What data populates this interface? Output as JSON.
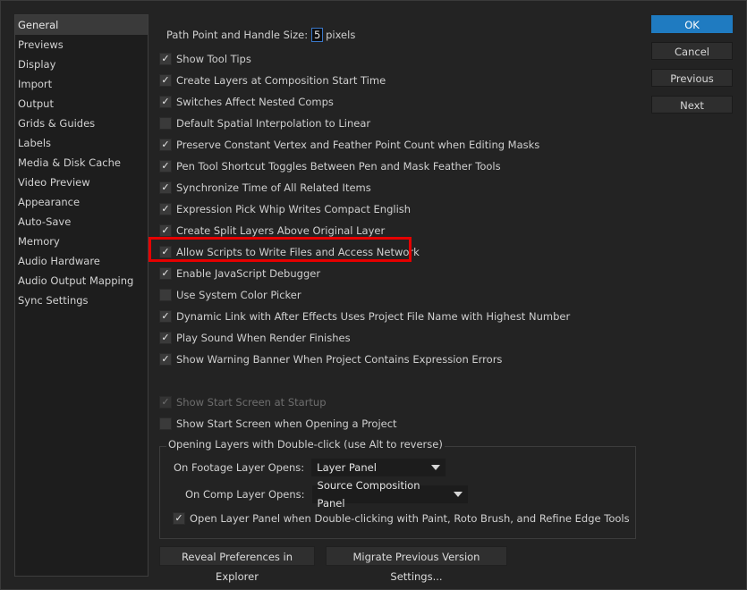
{
  "sidebar": {
    "items": [
      {
        "label": "General",
        "active": true
      },
      {
        "label": "Previews"
      },
      {
        "label": "Display"
      },
      {
        "label": "Import"
      },
      {
        "label": "Output"
      },
      {
        "label": "Grids & Guides"
      },
      {
        "label": "Labels"
      },
      {
        "label": "Media & Disk Cache"
      },
      {
        "label": "Video Preview"
      },
      {
        "label": "Appearance"
      },
      {
        "label": "Auto-Save"
      },
      {
        "label": "Memory"
      },
      {
        "label": "Audio Hardware"
      },
      {
        "label": "Audio Output Mapping"
      },
      {
        "label": "Sync Settings"
      }
    ]
  },
  "path_point": {
    "label": "Path Point and Handle Size:",
    "value": "5",
    "unit": "pixels"
  },
  "checkboxes": [
    {
      "label": "Show Tool Tips",
      "checked": true
    },
    {
      "label": "Create Layers at Composition Start Time",
      "checked": true
    },
    {
      "label": "Switches Affect Nested Comps",
      "checked": true
    },
    {
      "label": "Default Spatial Interpolation to Linear",
      "checked": false
    },
    {
      "label": "Preserve Constant Vertex and Feather Point Count when Editing Masks",
      "checked": true
    },
    {
      "label": "Pen Tool Shortcut Toggles Between Pen and Mask Feather Tools",
      "checked": true
    },
    {
      "label": "Synchronize Time of All Related Items",
      "checked": true
    },
    {
      "label": "Expression Pick Whip Writes Compact English",
      "checked": true
    },
    {
      "label": "Create Split Layers Above Original Layer",
      "checked": true
    },
    {
      "label": "Allow Scripts to Write Files and Access Network",
      "checked": true
    },
    {
      "label": "Enable JavaScript Debugger",
      "checked": true
    },
    {
      "label": "Use System Color Picker",
      "checked": false
    },
    {
      "label": "Dynamic Link with After Effects Uses Project File Name with Highest Number",
      "checked": true
    },
    {
      "label": "Play Sound When Render Finishes",
      "checked": true
    },
    {
      "label": "Show Warning Banner When Project Contains Expression Errors",
      "checked": true
    }
  ],
  "start_screen": [
    {
      "label": "Show Start Screen at Startup",
      "checked": true,
      "disabled": true
    },
    {
      "label": "Show Start Screen when Opening a Project",
      "checked": false
    }
  ],
  "opening_layers": {
    "title": "Opening Layers with Double-click (use Alt to reverse)",
    "footage_label": "On Footage Layer Opens:",
    "footage_value": "Layer Panel",
    "comp_label": "On Comp Layer Opens:",
    "comp_value": "Source Composition Panel",
    "open_panel_label": "Open Layer Panel when Double-clicking with Paint, Roto Brush, and Refine Edge Tools",
    "open_panel_checked": true
  },
  "buttons": {
    "ok": "OK",
    "cancel": "Cancel",
    "previous": "Previous",
    "next": "Next",
    "reveal": "Reveal Preferences in Explorer",
    "migrate": "Migrate Previous Version Settings..."
  },
  "highlight_color": "#e50000",
  "accent_color": "#1f7bc1"
}
